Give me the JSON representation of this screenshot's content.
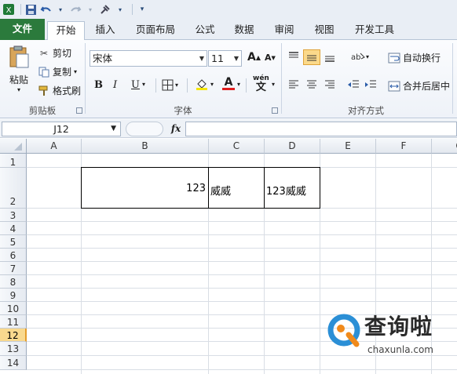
{
  "quick_access": {
    "save_icon": "save-icon",
    "undo_icon": "undo-icon",
    "redo_icon": "redo-icon",
    "tool_icon": "format-painter-icon"
  },
  "tabs": {
    "file": "文件",
    "items": [
      "开始",
      "插入",
      "页面布局",
      "公式",
      "数据",
      "审阅",
      "视图",
      "开发工具"
    ],
    "active": "开始"
  },
  "ribbon": {
    "clipboard": {
      "paste": "粘贴",
      "cut": "剪切",
      "copy": "复制",
      "format_painter": "格式刷",
      "label": "剪贴板"
    },
    "font": {
      "name": "宋体",
      "size": "11",
      "bold": "B",
      "italic": "I",
      "underline": "U",
      "grow": "A",
      "shrink": "A",
      "font_color": "A",
      "wen": "wén",
      "wen_char": "文",
      "label": "字体"
    },
    "alignment": {
      "wrap": "自动换行",
      "merge": "合并后居中",
      "label": "对齐方式"
    }
  },
  "formula_bar": {
    "name_box": "J12",
    "fx": "fx",
    "formula": ""
  },
  "sheet": {
    "columns": [
      "A",
      "B",
      "C",
      "D",
      "E",
      "F",
      "G"
    ],
    "rows": [
      "1",
      "2",
      "3",
      "4",
      "5",
      "6",
      "7",
      "8",
      "9",
      "10",
      "11",
      "12",
      "13",
      "14"
    ],
    "selected_row": "12",
    "cells": {
      "B2": "123",
      "C2": "威威",
      "D2": "123威威"
    }
  },
  "watermark": {
    "title": "查询啦",
    "url": "chaxunla.com"
  }
}
